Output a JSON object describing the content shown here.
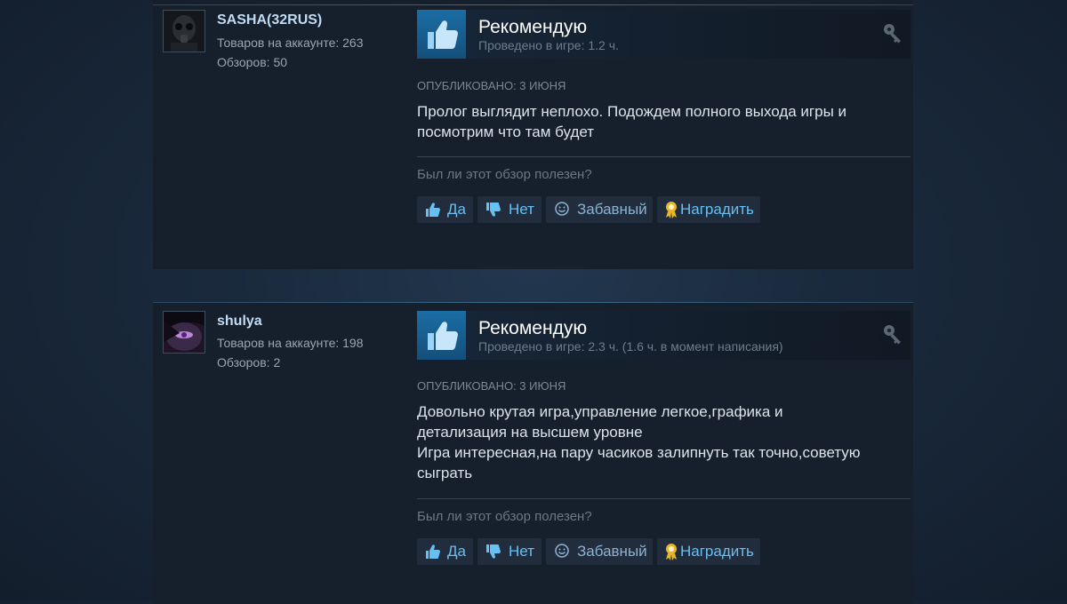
{
  "colors": {
    "panel": "#16202d",
    "accent_link": "#66c0f4",
    "author_name": "#c1dbf4",
    "thumb_blue": "#1b6da5"
  },
  "reviews": [
    {
      "author": {
        "name": "SASHA(32RUS)",
        "products": "Товаров на аккаунте: 263",
        "reviews": "Обзоров: 50",
        "avatar_icon": "gas-mask-avatar"
      },
      "verdict": "Рекомендую",
      "hours": "Проведено в игре: 1.2 ч.",
      "posted": "ОПУБЛИКОВАНО: 3 ИЮНЯ",
      "text_lines": [
        "Пролог выглядит неплохо. Подождем полного выхода игры и",
        "посмотрим что там будет"
      ],
      "helpful_question": "Был ли этот обзор полезен?",
      "buttons": {
        "yes": "Да",
        "no": "Нет",
        "funny": "Забавный",
        "award": "Наградить"
      }
    },
    {
      "author": {
        "name": "shulya",
        "products": "Товаров на аккаунте: 198",
        "reviews": "Обзоров: 2",
        "avatar_icon": "purple-eye-avatar"
      },
      "verdict": "Рекомендую",
      "hours": "Проведено в игре: 2.3 ч. (1.6 ч. в момент написания)",
      "posted": "ОПУБЛИКОВАНО: 3 ИЮНЯ",
      "text_lines": [
        "Довольно крутая игра,управление легкое,графика и",
        "детализация на высшем уровне",
        "Игра интересная,на пару часиков залипнуть так точно,советую",
        "сыграть"
      ],
      "helpful_question": "Был ли этот обзор полезен?",
      "buttons": {
        "yes": "Да",
        "no": "Нет",
        "funny": "Забавный",
        "award": "Наградить"
      }
    }
  ]
}
